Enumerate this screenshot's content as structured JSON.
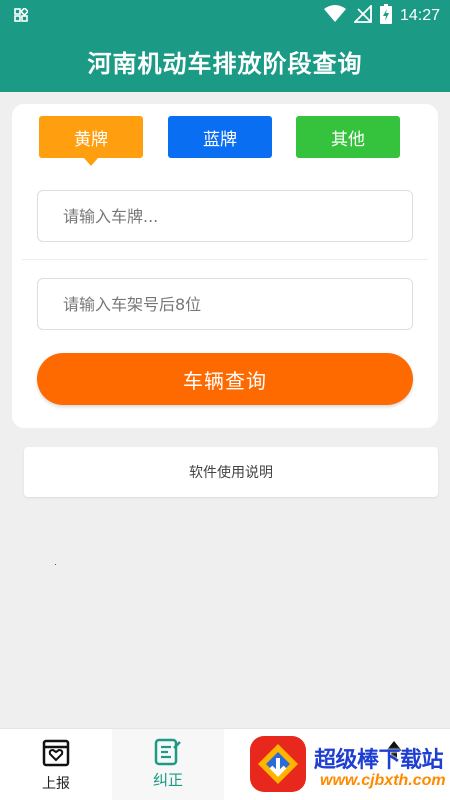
{
  "status_bar": {
    "time": "14:27"
  },
  "header": {
    "title": "河南机动车排放阶段查询"
  },
  "plate_types": {
    "yellow": "黄牌",
    "blue": "蓝牌",
    "other": "其他"
  },
  "form": {
    "plate_placeholder": "请输入车牌...",
    "vin_placeholder": "请输入车架号后8位",
    "query_button": "车辆查询"
  },
  "help": {
    "label": "软件使用说明"
  },
  "bottom_nav": {
    "report": "上报",
    "correct": "纠正"
  },
  "watermark": {
    "text": "超级棒下载站",
    "url": "www.cjbxth.com"
  },
  "colors": {
    "theme": "#1b9a85",
    "yellow_plate": "#ff9f10",
    "blue_plate": "#0a6ef3",
    "other_plate": "#35c23c",
    "query_button": "#ff6a00"
  }
}
